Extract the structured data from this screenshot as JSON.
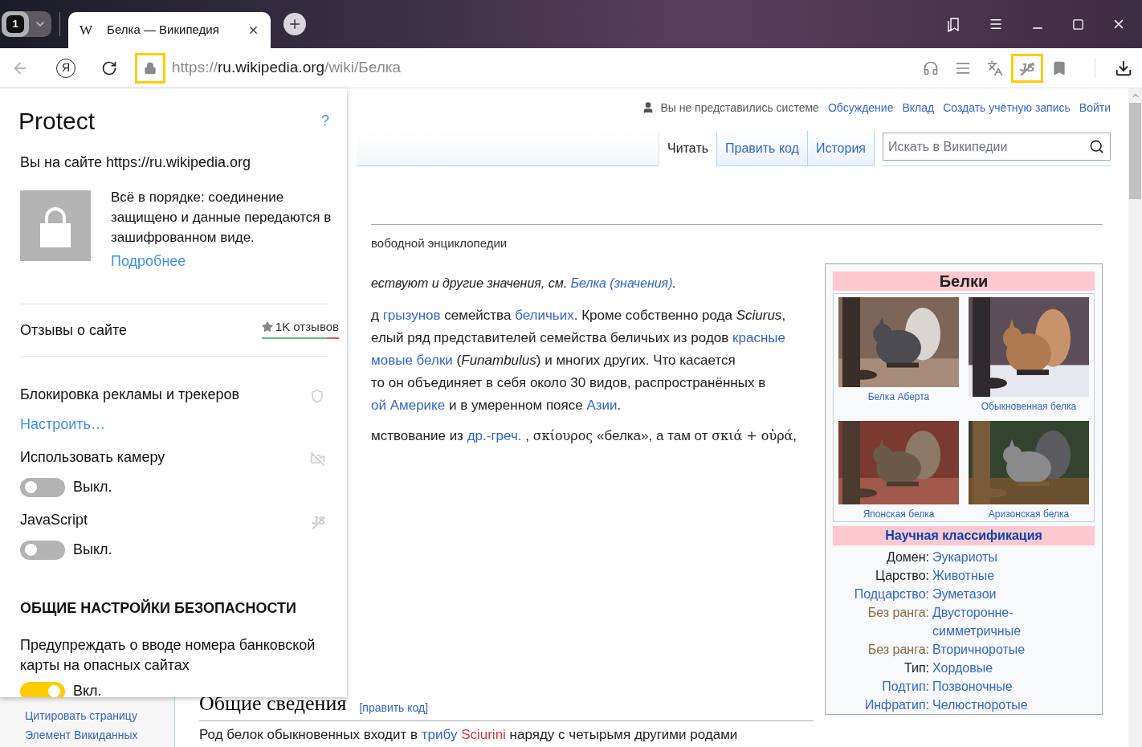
{
  "browser": {
    "tab_counter": "1",
    "tab": {
      "icon_letter": "W",
      "title": "Белка — Википедия"
    },
    "home_letter": "Я",
    "back_disabled": true,
    "lock_highlighted": true,
    "url": {
      "scheme": "https://",
      "host": "ru.wikipedia.org",
      "path": "/wiki/Белка"
    },
    "toolbar": [
      {
        "kind": "headphones",
        "highlighted": false
      },
      {
        "kind": "reader",
        "highlighted": false
      },
      {
        "kind": "translate",
        "highlighted": false
      },
      {
        "kind": "javascript",
        "label": "JS",
        "highlighted": true
      },
      {
        "kind": "bookmark",
        "highlighted": false
      }
    ]
  },
  "protect": {
    "title": "Protect",
    "help": "?",
    "site_line": "Вы на сайте https://ru.wikipedia.org",
    "status": "Всё в порядке: соединение защищено и данные передаются в зашифрованном виде.",
    "more_link": "Подробнее",
    "reviews": {
      "label": "Отзывы о сайте",
      "count": "1K отзывов",
      "level": 0.84
    },
    "ad_block": {
      "label": "Блокировка рекламы и трекеров",
      "link": "Настроить…"
    },
    "permissions": [
      {
        "kind": "camera",
        "label": "Использовать камеру",
        "on": false,
        "state": "Выкл."
      },
      {
        "kind": "javascript",
        "label": "JavaScript",
        "icon_text": "JS",
        "on": false,
        "state": "Выкл."
      }
    ],
    "section_title": "ОБЩИЕ НАСТРОЙКИ БЕЗОПАСНОСТИ",
    "card_warning": {
      "label": "Предупреждать о вводе номера банковской карты на опасных сайтах",
      "on": true,
      "state": "Вкл."
    }
  },
  "wiki": {
    "personal": {
      "anon": "Вы не представились системе",
      "links": [
        "Обсуждение",
        "Вклад",
        "Создать учётную запись",
        "Войти"
      ]
    },
    "tabs": [
      {
        "label": "Читать",
        "selected": true
      },
      {
        "label": "Править код",
        "selected": false
      },
      {
        "label": "История",
        "selected": false
      }
    ],
    "search": {
      "placeholder": "Искать в Википедии"
    },
    "tagline": "вободной энциклопедии",
    "hatnote": [
      {
        "kind": "text",
        "text": "ествуют и другие значения, см. "
      },
      {
        "kind": "link",
        "text": "Белка (значения)"
      },
      {
        "kind": "text",
        "text": "."
      }
    ],
    "lead_lines": [
      [
        {
          "kind": "text",
          "text": "д "
        },
        {
          "kind": "link",
          "text": "грызунов"
        },
        {
          "kind": "text",
          "text": " семейства "
        },
        {
          "kind": "link",
          "text": "беличьих"
        },
        {
          "kind": "text",
          "text": ". Кроме собственно рода *Sciurus*,"
        }
      ],
      [
        {
          "kind": "text",
          "text": "елый ряд представителей семейства беличьих из родов "
        },
        {
          "kind": "link",
          "text": "красные"
        }
      ],
      [
        {
          "kind": "link",
          "text": "мовые белки"
        },
        {
          "kind": "text",
          "text": " (*Funambulus*) и многих других. Что касается"
        }
      ],
      [
        {
          "kind": "text",
          "text": "то он объединяет в себя около 30 видов, распространённых в"
        }
      ],
      [
        {
          "kind": "link",
          "text": "ой Америке"
        },
        {
          "kind": "text",
          "text": " и в умеренном поясе "
        },
        {
          "kind": "link",
          "text": "Азии"
        },
        {
          "kind": "text",
          "text": "."
        }
      ]
    ],
    "etymology": [
      {
        "kind": "text",
        "text": "мствование из "
      },
      {
        "kind": "link",
        "text": "др.-греч."
      },
      {
        "kind": "text",
        "text": " , "
      },
      {
        "kind": "greek",
        "text": "σκίουρος"
      },
      {
        "kind": "text",
        "text": " «белка», а там от "
      },
      {
        "kind": "greek",
        "text": "σκιά + οὐρά"
      },
      {
        "kind": "text",
        "text": ","
      }
    ],
    "section": {
      "heading": "Общие сведения",
      "edit": "[править код]"
    },
    "section_text": [
      {
        "kind": "text",
        "text": "Род белок обыкновенных входит в "
      },
      {
        "kind": "link",
        "text": "трибу"
      },
      {
        "kind": "redlink",
        "text": "Sciurini"
      },
      {
        "kind": "text",
        "text": " наряду с четырьмя другими родами"
      }
    ],
    "sidebar_links": [
      "Цитировать страницу",
      "Элемент Викиданных"
    ],
    "infobox": {
      "title": "Белки",
      "images": [
        {
          "caption": "Белка Аберта"
        },
        {
          "caption": "Обыкновенная белка"
        },
        {
          "caption": "Японская белка"
        },
        {
          "caption": "Аризонская белка"
        }
      ],
      "classification_title": "Научная классификация",
      "rows": [
        {
          "label": "Домен:",
          "kind": "plain",
          "value": "Эукариоты"
        },
        {
          "label": "Царство:",
          "kind": "plain",
          "value": "Животные"
        },
        {
          "label": "Подцарство:",
          "kind": "link",
          "value": "Эуметазои"
        },
        {
          "label": "Без ранга:",
          "kind": "rank",
          "value": "Двусторонне-симметричные"
        },
        {
          "label": "Без ранга:",
          "kind": "rank",
          "value": "Вторичноротые"
        },
        {
          "label": "Тип:",
          "kind": "plain",
          "value": "Хордовые"
        },
        {
          "label": "Подтип:",
          "kind": "link",
          "value": "Позвоночные"
        },
        {
          "label": "Инфратип:",
          "kind": "link",
          "value": "Челюстноротые"
        }
      ]
    }
  }
}
